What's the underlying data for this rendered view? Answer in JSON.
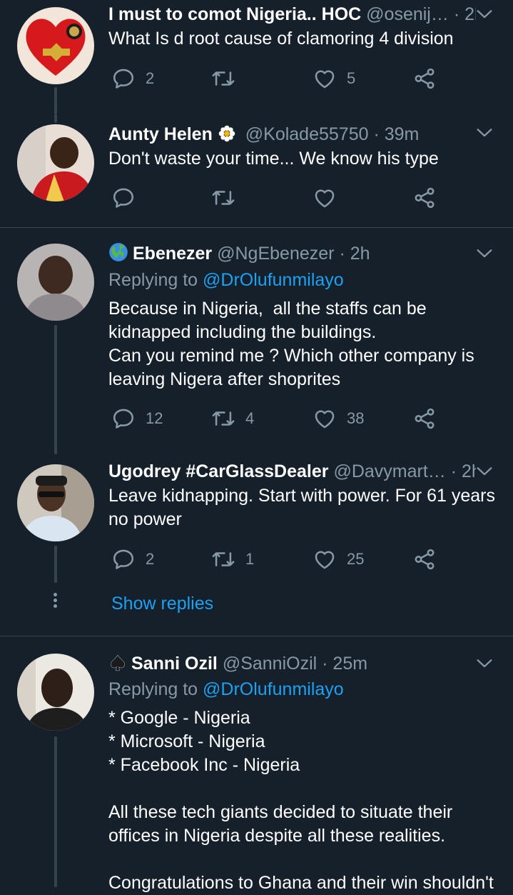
{
  "tweets": [
    {
      "name": "I must to comot Nigeria.. HOC",
      "handle": "@osenij…",
      "time": "· 2h",
      "text": "What Is d root cause of clamoring 4 division",
      "replies": "2",
      "retweets": "",
      "likes": "5"
    },
    {
      "name": "Aunty Helen",
      "handle": "@Kolade55750",
      "time": "· 39m",
      "text": "Don't waste your time... We know his type",
      "replies": "",
      "retweets": "",
      "likes": ""
    },
    {
      "name": "Ebenezer",
      "handle": "@NgEbenezer",
      "time": "· 2h",
      "replying_label": "Replying to",
      "replying_to": "@DrOlufunmilayo",
      "text": "Because in Nigeria,  all the staffs can be kidnapped including the buildings.\nCan you remind me ? Which other company is leaving Nigera after shoprites",
      "replies": "12",
      "retweets": "4",
      "likes": "38"
    },
    {
      "name": "Ugodrey #CarGlassDealer",
      "handle": "@Davymart…",
      "time": "· 2h",
      "text": "Leave kidnapping. Start with power. For 61 years no power",
      "replies": "2",
      "retweets": "1",
      "likes": "25"
    },
    {
      "name": "Sanni Ozil",
      "handle": "@SanniOzil",
      "time": "· 25m",
      "replying_label": "Replying to",
      "replying_to": "@DrOlufunmilayo",
      "text": "* Google - Nigeria\n* Microsoft - Nigeria\n* Facebook Inc - Nigeria\n\nAll these tech giants decided to situate their offices in Nigeria despite all these realities.\n\nCongratulations to Ghana and their win shouldn't"
    }
  ],
  "show_replies": "Show replies",
  "colors": {
    "background": "#15202b",
    "secondary_text": "#8899a6",
    "accent": "#1da1f2",
    "divider": "#38444d"
  },
  "icons": [
    "reply-icon",
    "retweet-icon",
    "like-icon",
    "share-icon",
    "chevron-down-icon",
    "flower-icon",
    "globe-icon",
    "spade-icon"
  ]
}
